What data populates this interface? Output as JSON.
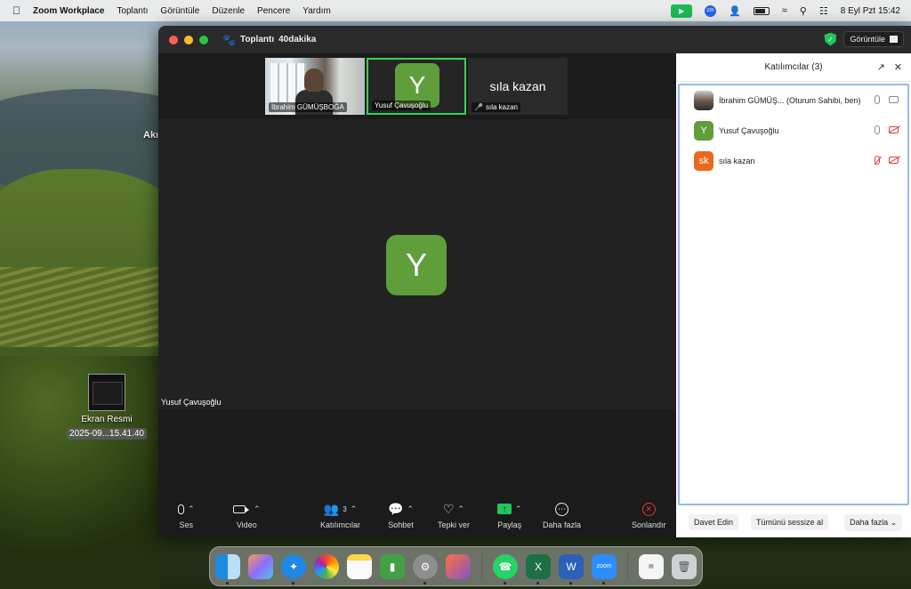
{
  "menubar": {
    "app_name": "Zoom Workplace",
    "items": [
      "Toplantı",
      "Görüntüle",
      "Düzenle",
      "Pencere",
      "Yardım"
    ],
    "datetime": "8 Eyl Pzt  15:42",
    "zm_badge": "zm"
  },
  "desktop": {
    "file_name": "Ekran Resmi",
    "file_sub": "2025-09...15.41.40",
    "partial_label": "Akı"
  },
  "zoom": {
    "title": "Toplantı",
    "timer": "40dakika",
    "view_button": "Görüntüle",
    "thumbnails": [
      {
        "name": "İbrahim GÜMÜŞBOĞA"
      },
      {
        "name": "Yusuf Çavuşoğlu",
        "initial": "Y"
      },
      {
        "name": "sıla kazan",
        "display": "sıla kazan"
      }
    ],
    "speaker": {
      "initial": "Y",
      "name": "Yusuf Çavuşoğlu"
    },
    "toolbar": {
      "audio": "Ses",
      "video": "Video",
      "participants": "Katılımcılar",
      "participants_count": "3",
      "chat": "Sohbet",
      "react": "Tepki ver",
      "share": "Paylaş",
      "more": "Daha fazla",
      "end": "Sonlandır"
    }
  },
  "panel": {
    "title": "Katılımcılar (3)",
    "participants": [
      {
        "name": "İbrahim GÜMÜŞ...  (Oturum Sahibi, ben)",
        "initial": ""
      },
      {
        "name": "Yusuf Çavuşoğlu",
        "initial": "Y"
      },
      {
        "name": "sıla kazan",
        "initial": "sk"
      }
    ],
    "invite": "Davet Edin",
    "mute_all": "Tümünü sessize al",
    "more": "Daha fazla"
  },
  "colors": {
    "zoom_green": "#5f9e3a",
    "active_border": "#3ecf5c",
    "sk_orange": "#e86a1a",
    "end_red": "#e53935"
  }
}
